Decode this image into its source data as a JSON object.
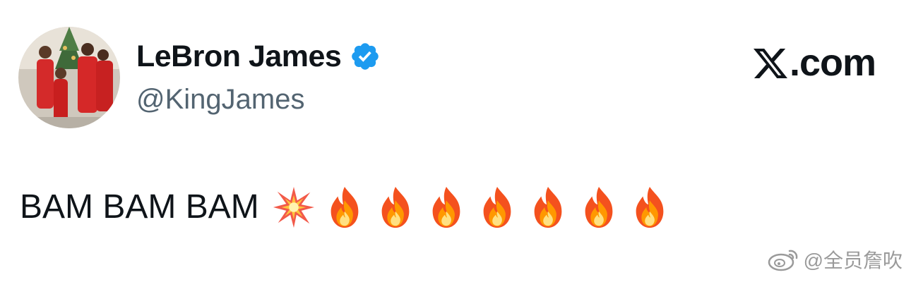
{
  "author": {
    "display_name": "LeBron James",
    "handle": "@KingJames",
    "verified": true,
    "avatar": "profile-photo-family-red-outfits",
    "verified_icon": "verified-badge-icon",
    "verified_color": "#1d9bf0"
  },
  "brand": {
    "logo": "x-logo-icon",
    "label": ".com"
  },
  "tweet": {
    "text": "BAM BAM BAM",
    "emojis": [
      "collision-emoji",
      "fire-emoji",
      "fire-emoji",
      "fire-emoji",
      "fire-emoji",
      "fire-emoji",
      "fire-emoji",
      "fire-emoji"
    ]
  },
  "watermark": {
    "icon": "weibo-icon",
    "text": "@全员詹吹"
  },
  "colors": {
    "text_primary": "#0f1419",
    "text_secondary": "#536471",
    "background": "#ffffff"
  }
}
